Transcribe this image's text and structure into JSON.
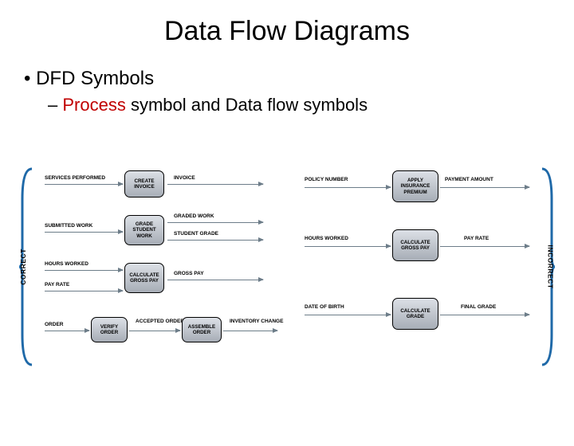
{
  "title": "Data Flow Diagrams",
  "bullet1_prefix": "• ",
  "bullet1": "DFD Symbols",
  "bullet2_dash": "– ",
  "bullet2_process": "Process",
  "bullet2_rest": " symbol and Data flow symbols",
  "label_correct": "CORRECT",
  "label_incorrect": "INCORRECT",
  "correct_rows": [
    {
      "in": [
        {
          "t": "SERVICES PERFORMED"
        }
      ],
      "proc": "CREATE INVOICE",
      "out": [
        {
          "t": "INVOICE"
        }
      ]
    },
    {
      "in": [
        {
          "t": "SUBMITTED WORK"
        }
      ],
      "proc": "GRADE STUDENT WORK",
      "out": [
        {
          "t": "GRADED WORK"
        },
        {
          "t": "STUDENT GRADE"
        }
      ]
    },
    {
      "in": [
        {
          "t": "HOURS WORKED"
        },
        {
          "t": "PAY RATE"
        }
      ],
      "proc": "CALCULATE GROSS PAY",
      "out": [
        {
          "t": "GROSS PAY"
        }
      ]
    },
    {
      "in": [
        {
          "t": "ORDER"
        }
      ],
      "proc": "VERIFY ORDER",
      "mid": [
        {
          "t": "ACCEPTED ORDER"
        }
      ],
      "proc2": "ASSEMBLE ORDER",
      "out": [
        {
          "t": "INVENTORY CHANGE"
        }
      ]
    }
  ],
  "incorrect_rows": [
    {
      "in": [
        {
          "t": "POLICY NUMBER"
        }
      ],
      "proc": "APPLY INSURANCE PREMIUM",
      "out": [
        {
          "t": "PAYMENT AMOUNT"
        }
      ]
    },
    {
      "in": [
        {
          "t": "HOURS WORKED"
        }
      ],
      "proc": "CALCULATE GROSS PAY",
      "out": [
        {
          "t": "PAY RATE"
        }
      ]
    },
    {
      "in": [
        {
          "t": "DATE OF BIRTH"
        }
      ],
      "proc": "CALCULATE GRADE",
      "out": [
        {
          "t": "FINAL GRADE"
        }
      ]
    }
  ]
}
